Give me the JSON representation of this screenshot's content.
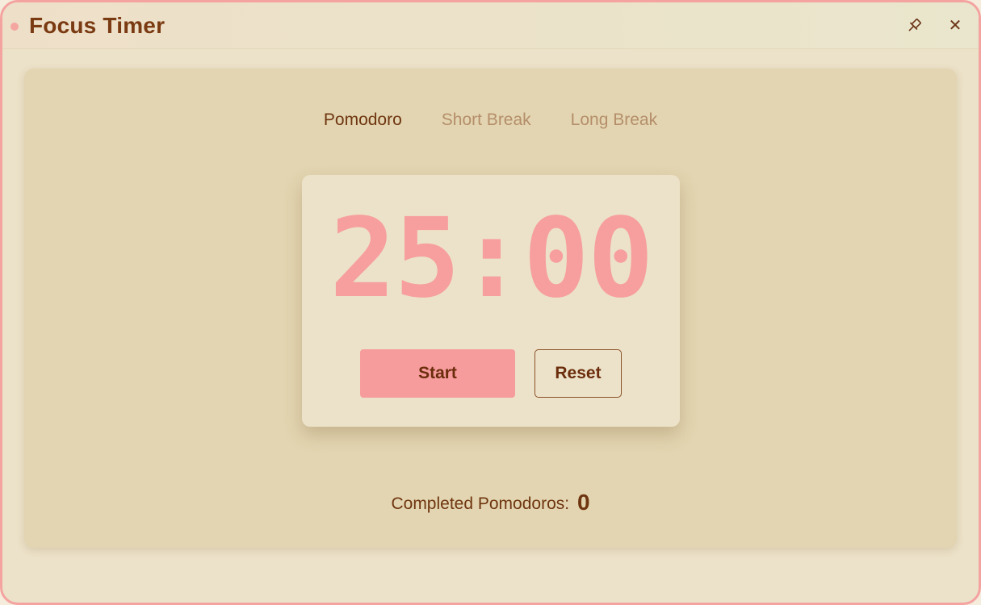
{
  "window": {
    "title": "Focus Timer"
  },
  "icons": {
    "pin": "pin-icon",
    "close": "close-icon",
    "close_glyph": "✕"
  },
  "tabs": [
    {
      "label": "Pomodoro",
      "active": true
    },
    {
      "label": "Short Break",
      "active": false
    },
    {
      "label": "Long Break",
      "active": false
    }
  ],
  "timer": {
    "display": "25:00"
  },
  "buttons": {
    "start_label": "Start",
    "reset_label": "Reset"
  },
  "stats": {
    "completed_label": "Completed Pomodoros:",
    "completed_count": "0"
  },
  "colors": {
    "accent": "#f79c9d",
    "text": "#6e3510",
    "inactive_tab": "#b58e6a",
    "border": "#f4a3a0"
  }
}
